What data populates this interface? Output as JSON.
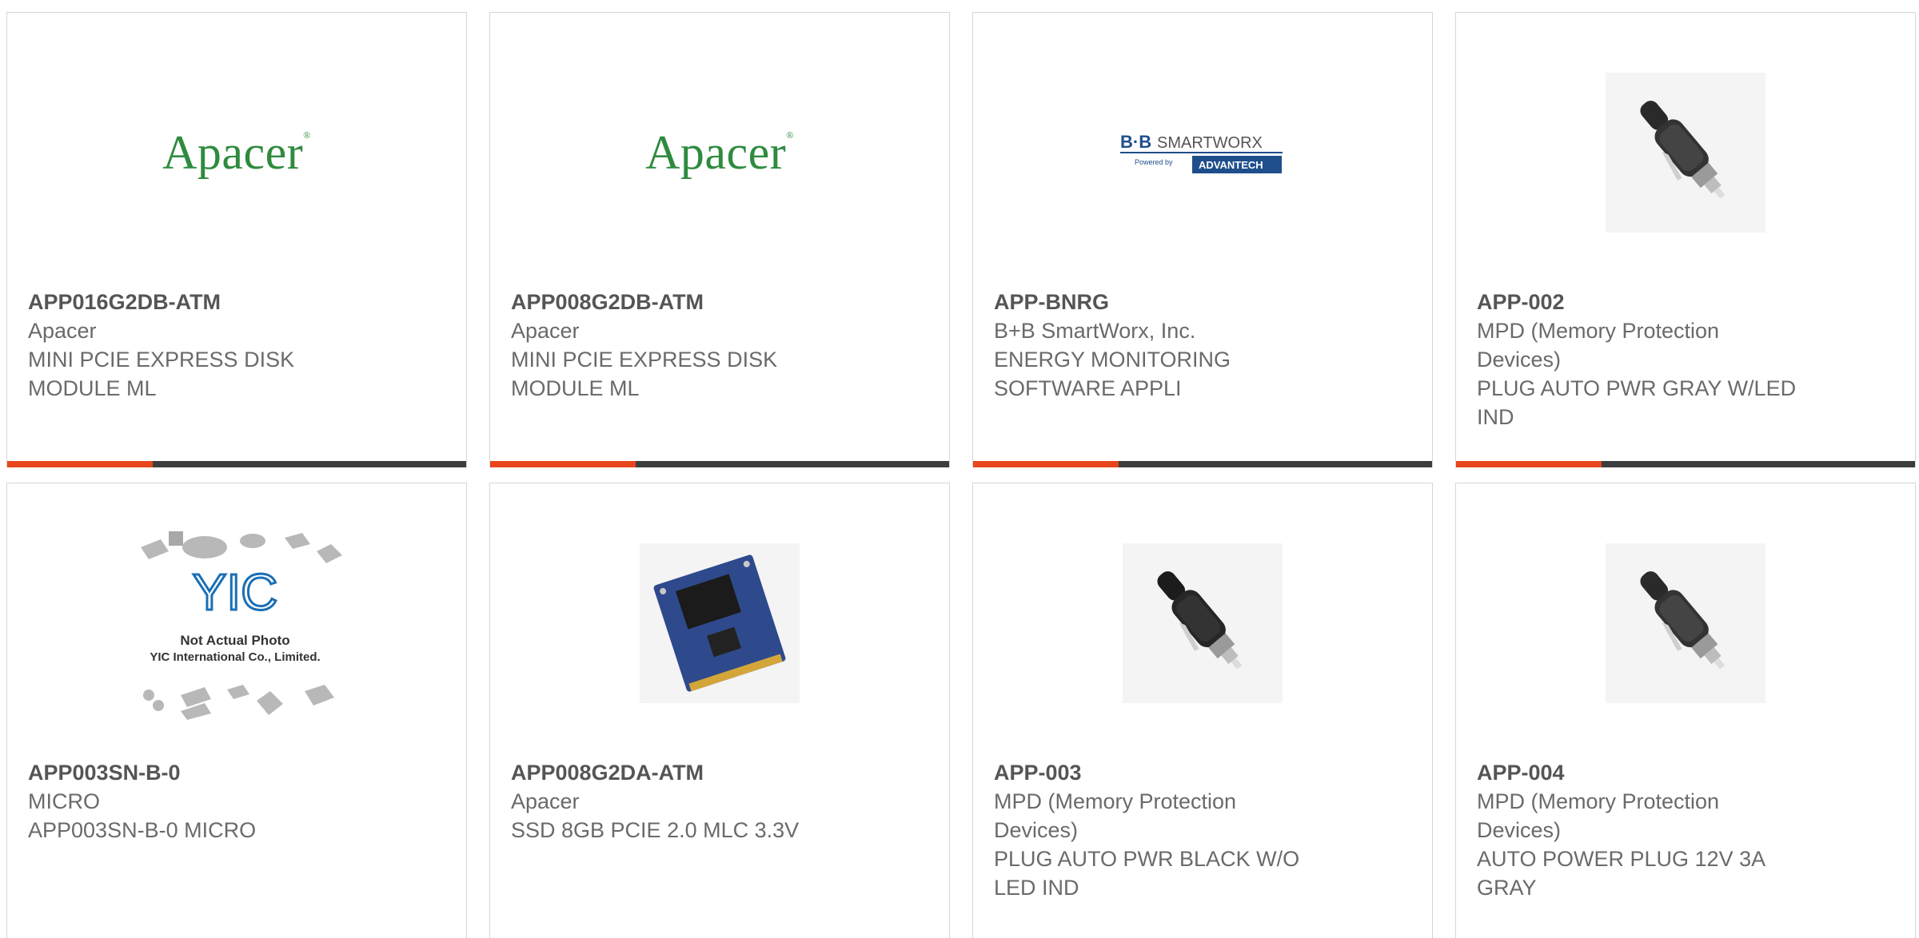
{
  "colors": {
    "accent": "#e8461e",
    "bar": "#3d3d3d",
    "part": "#555555",
    "text": "#6a6a6a",
    "apacer_green": "#2e8b3e",
    "advantech_blue": "#1f4e8c"
  },
  "products": [
    {
      "part": "APP016G2DB-ATM",
      "lines": [
        "Apacer",
        "MINI PCIE EXPRESS DISK",
        "MODULE ML"
      ],
      "image": "apacer-logo",
      "logo_text": "Apacer",
      "progress": 0.32
    },
    {
      "part": "APP008G2DB-ATM",
      "lines": [
        "Apacer",
        "MINI PCIE EXPRESS DISK",
        "MODULE ML"
      ],
      "image": "apacer-logo",
      "logo_text": "Apacer",
      "progress": 0.32
    },
    {
      "part": "APP-BNRG",
      "lines": [
        "B+B SmartWorx, Inc.",
        "ENERGY MONITORING",
        "SOFTWARE APPLI"
      ],
      "image": "bb-smartworx-logo",
      "logo_text": "B+B SmartWorx Powered by ADVANTECH",
      "progress": 0.32
    },
    {
      "part": "APP-002",
      "lines": [
        "MPD (Memory Protection",
        "Devices)",
        "PLUG AUTO PWR GRAY W/LED",
        "IND"
      ],
      "image": "auto-plug-photo",
      "progress": 0.32
    },
    {
      "part": "APP003SN-B-0",
      "lines": [
        "MICRO",
        "APP003SN-B-0 MICRO"
      ],
      "image": "not-actual-photo",
      "logo_text": "YIC Not Actual Photo YIC International Co., Limited."
    },
    {
      "part": "APP008G2DA-ATM",
      "lines": [
        "Apacer",
        "SSD 8GB PCIE 2.0 MLC 3.3V"
      ],
      "image": "msata-ssd-photo"
    },
    {
      "part": "APP-003",
      "lines": [
        "MPD (Memory Protection",
        "Devices)",
        "PLUG AUTO PWR BLACK W/O",
        "LED IND"
      ],
      "image": "auto-plug-photo"
    },
    {
      "part": "APP-004",
      "lines": [
        "MPD (Memory Protection",
        "Devices)",
        "AUTO POWER PLUG 12V 3A",
        "GRAY"
      ],
      "image": "auto-plug-photo"
    }
  ]
}
